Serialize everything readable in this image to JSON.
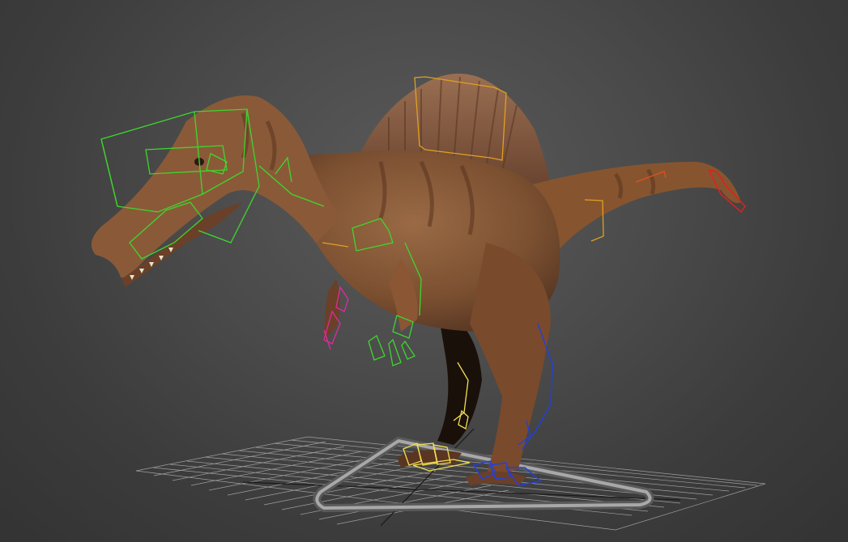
{
  "viewport": {
    "view_mode": "perspective",
    "shading": "textured",
    "background_color": "#3f3f3f",
    "grid_visible": true,
    "grid_color": "#b8b8b8"
  },
  "scene": {
    "model": "spinosaurus",
    "rig": "biped",
    "rig_colors": {
      "head_neck_arms": "#3ed62e",
      "spine_tail_controls": "#e0a020",
      "right_arm": "#e02a9a",
      "right_leg": "#f2e050",
      "left_leg": "#2040e0",
      "tail_tip": "#e02020",
      "root_control": "#9a9a9a"
    }
  }
}
